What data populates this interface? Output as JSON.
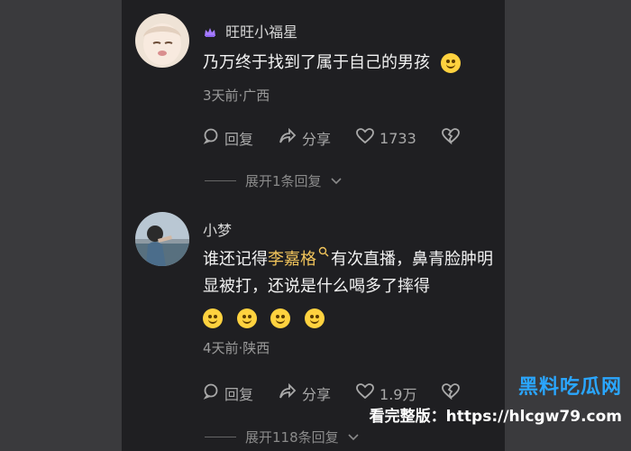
{
  "comments": [
    {
      "username": "旺旺小福星",
      "text": "乃万终于找到了属于自己的男孩",
      "meta": "3天前·广西",
      "reply_label": "回复",
      "share_label": "分享",
      "like_count": "1733",
      "expand_label": "展开1条回复"
    },
    {
      "username": "小梦",
      "text_parts": {
        "before": "谁还记得",
        "highlight": "李嘉格",
        "after": "有次直播，鼻青脸肿明显被打，还说是什么喝多了摔得"
      },
      "meta": "4天前·陕西",
      "reply_label": "回复",
      "share_label": "分享",
      "like_count": "1.9万",
      "expand_label": "展开118条回复"
    }
  ],
  "watermark": {
    "title": "黑料吃瓜网",
    "subtitle": "看完整版：https://hlcgw79.com"
  }
}
